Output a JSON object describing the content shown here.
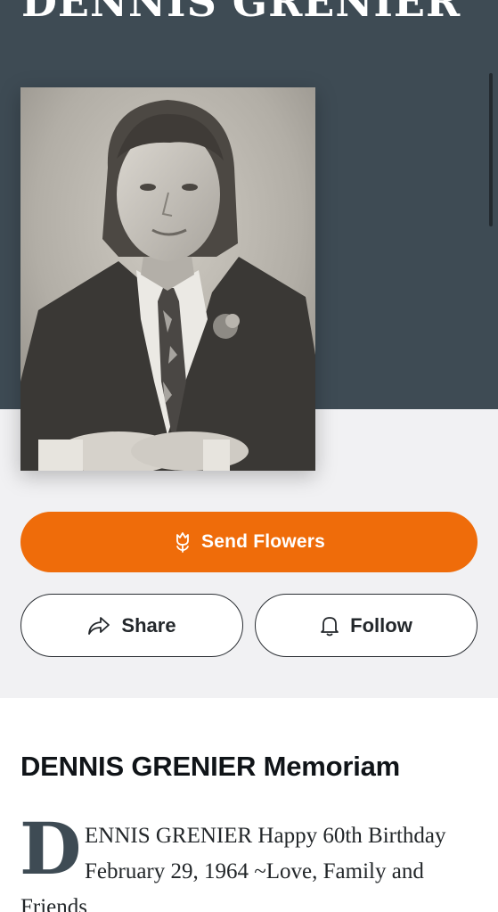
{
  "header": {
    "title": "DENNIS GRENIER"
  },
  "photo": {
    "alt": "Portrait of Dennis Grenier"
  },
  "actions": {
    "send_flowers_label": "Send Flowers",
    "share_label": "Share",
    "follow_label": "Follow"
  },
  "memoriam": {
    "title": "DENNIS GRENIER Memoriam",
    "drop_cap": "D",
    "lines": [
      "ENNIS GRENIER Happy 60th Birthday",
      "February 29, 1964 ~Love, Family and",
      "Friends"
    ]
  },
  "colors": {
    "header_bg": "#3e4b54",
    "accent": "#ef6c0a",
    "band_bg": "#f1f1f3"
  },
  "icons": {
    "flowers": "tulip-icon",
    "share": "share-arrow-icon",
    "follow": "bell-icon"
  }
}
